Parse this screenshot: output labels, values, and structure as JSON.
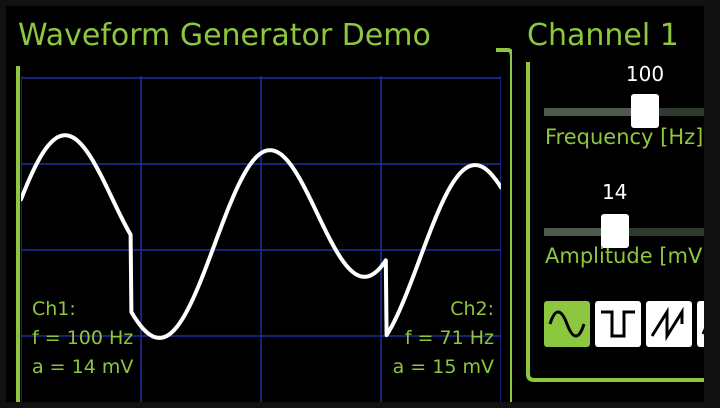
{
  "title": "Waveform Generator Demo",
  "colors": {
    "accent": "#8dc63f",
    "background": "#000000",
    "grid": "#1f2fa0",
    "trace": "#ffffff"
  },
  "scope": {
    "ch1": {
      "label": "Ch1:",
      "freq": "f = 100 Hz",
      "amp": "a = 14 mV"
    },
    "ch2": {
      "label": "Ch2:",
      "freq": "f = 71 Hz",
      "amp": "a = 15 mV"
    }
  },
  "panel": {
    "title": "Channel 1",
    "frequency": {
      "value": "100",
      "label": "Frequency [Hz]",
      "level": 0.5
    },
    "amplitude": {
      "value": "14",
      "label": "Amplitude [mV]",
      "level": 0.35
    },
    "waveforms": [
      {
        "icon": "sine-wave-icon",
        "selected": true
      },
      {
        "icon": "square-wave-icon",
        "selected": false
      },
      {
        "icon": "sawtooth-wave-icon",
        "selected": false
      },
      {
        "icon": "triangle-wave-icon",
        "selected": false
      }
    ]
  }
}
